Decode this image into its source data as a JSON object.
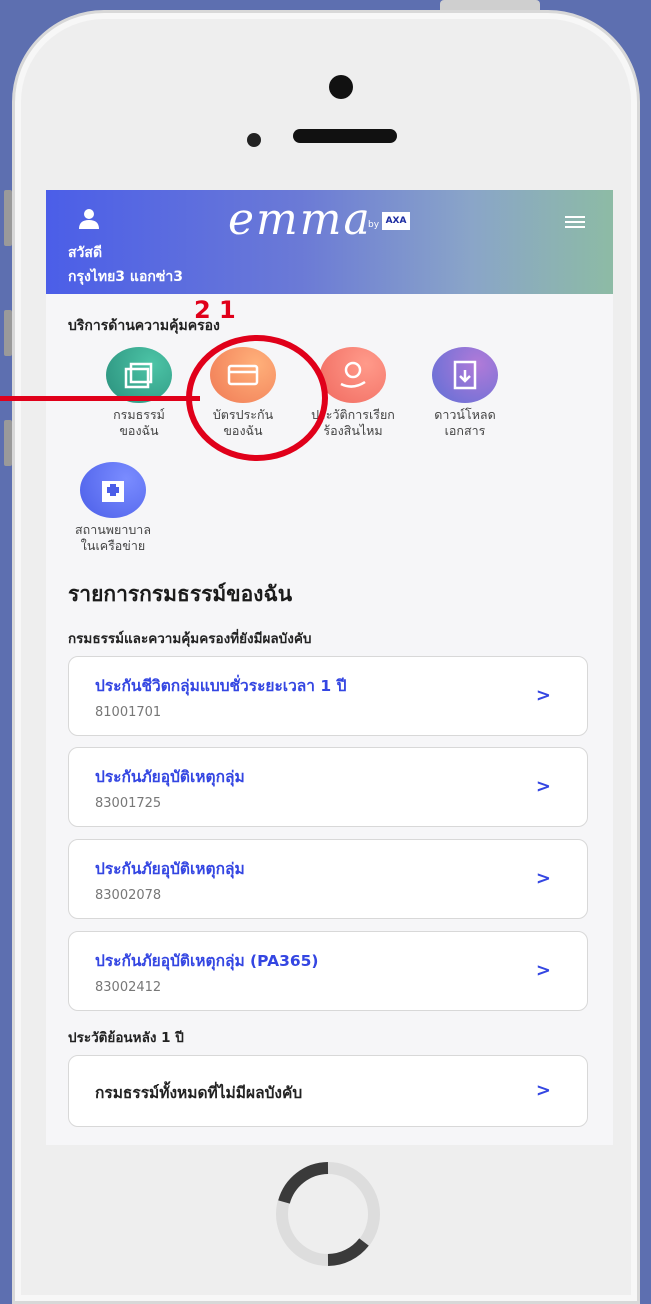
{
  "header": {
    "greeting": "สวัสดี",
    "user_name": "กรุงไทย3 แอกซ่า3",
    "logo_text": "emma",
    "logo_by": "by",
    "logo_axa": "AXA"
  },
  "services": {
    "title": "บริการด้านความคุ้มครอง",
    "overlay_number": "2 1",
    "items": [
      {
        "label_1": "กรมธรรม์",
        "label_2": "ของฉัน",
        "icon": "policy-folder-icon",
        "color": "#2a8f7c"
      },
      {
        "label_1": "บัตรประกัน",
        "label_2": "ของฉัน",
        "icon": "insurance-card-icon",
        "color": "#f07a55"
      },
      {
        "label_1": "ประวัติการเรียก",
        "label_2": "ร้องสินไหม",
        "icon": "claim-history-icon",
        "color": "#f0695f"
      },
      {
        "label_1": "ดาวน์โหลด",
        "label_2": "เอกสาร",
        "icon": "download-document-icon",
        "color": "#5f6fd6"
      },
      {
        "label_1": "สถานพยาบาล",
        "label_2": "ในเครือข่าย",
        "icon": "hospital-icon",
        "color": "#4b5ee8"
      }
    ]
  },
  "policy_list": {
    "title": "รายการกรมธรรม์ของฉัน",
    "active_subtitle": "กรมธรรม์และความคุ้มครองที่ยังมีผลบังคับ",
    "policies": [
      {
        "name": "ประกันชีวิตกลุ่มแบบชั่วระยะเวลา 1 ปี",
        "number": "81001701"
      },
      {
        "name": "ประกันภัยอุบัติเหตุกลุ่ม",
        "number": "83001725"
      },
      {
        "name": "ประกันภัยอุบัติเหตุกลุ่ม",
        "number": "83002078"
      },
      {
        "name": "ประกันภัยอุบัติเหตุกลุ่ม (PA365)",
        "number": "83002412"
      }
    ],
    "history_title": "ประวัติย้อนหลัง 1 ปี",
    "inactive_link": "กรมธรรม์ทั้งหมดที่ไม่มีผลบังคับ",
    "chevron": ">"
  },
  "colors": {
    "accent": "#3446e2",
    "highlight": "#e0001a"
  }
}
